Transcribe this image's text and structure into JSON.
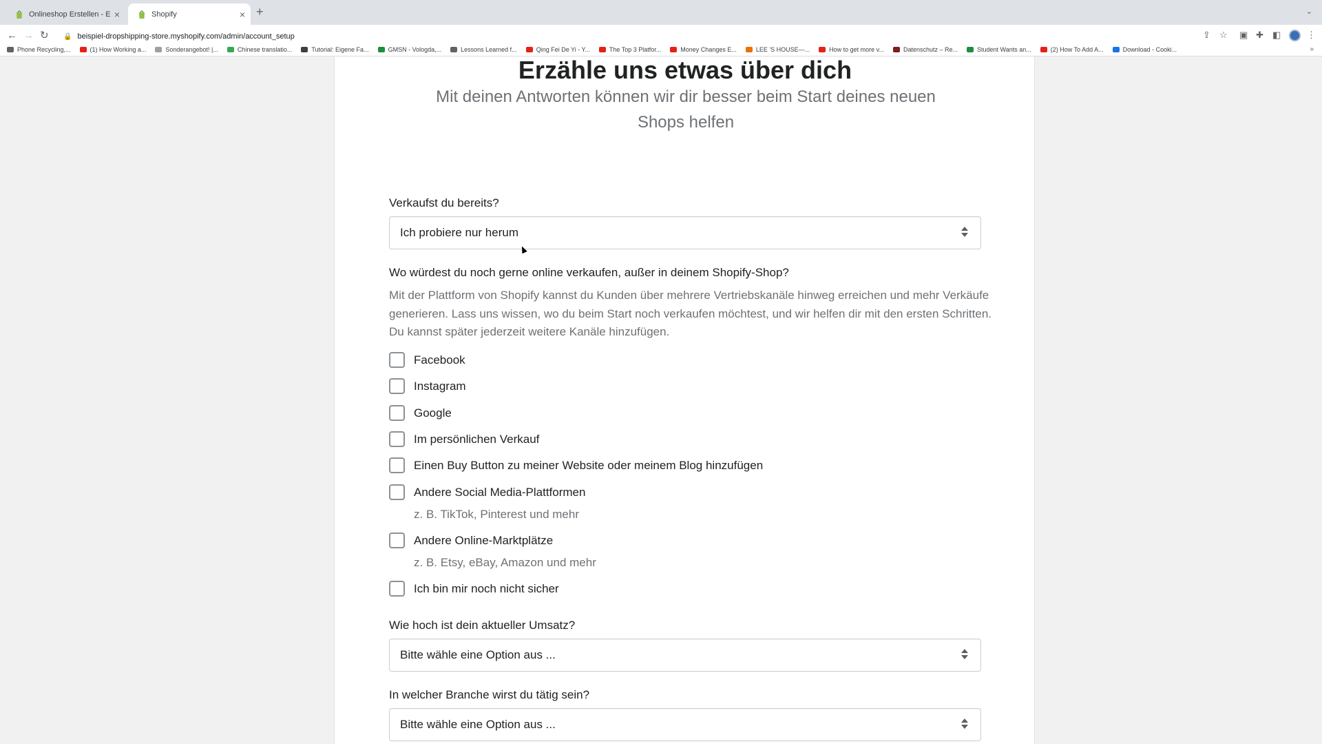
{
  "browser": {
    "tabs": [
      {
        "title": "Onlineshop Erstellen - Einfach",
        "active": false
      },
      {
        "title": "Shopify",
        "active": true
      }
    ],
    "url": "beispiel-dropshipping-store.myshopify.com/admin/account_setup",
    "bookmarks": [
      {
        "label": "Phone Recycling,...",
        "color": "#5f6368"
      },
      {
        "label": "(1) How Working a...",
        "color": "#e62117"
      },
      {
        "label": "Sonderangebot! |...",
        "color": "#9aa0a6"
      },
      {
        "label": "Chinese translatio...",
        "color": "#34a853"
      },
      {
        "label": "Tutorial: Eigene Fa...",
        "color": "#3c4043"
      },
      {
        "label": "GMSN - Vologda,...",
        "color": "#1e8e3e"
      },
      {
        "label": "Lessons Learned f...",
        "color": "#5f6368"
      },
      {
        "label": "Qing Fei De Yi - Y...",
        "color": "#e62117"
      },
      {
        "label": "The Top 3 Platfor...",
        "color": "#e62117"
      },
      {
        "label": "Money Changes E...",
        "color": "#e62117"
      },
      {
        "label": "LEE 'S HOUSE—...",
        "color": "#e8710a"
      },
      {
        "label": "How to get more v...",
        "color": "#e62117"
      },
      {
        "label": "Datenschutz – Re...",
        "color": "#7b1f1f"
      },
      {
        "label": "Student Wants an...",
        "color": "#1e8e3e"
      },
      {
        "label": "(2) How To Add A...",
        "color": "#e62117"
      },
      {
        "label": "Download - Cooki...",
        "color": "#1a73e8"
      }
    ]
  },
  "page": {
    "title": "Erzähle uns etwas über dich",
    "subtitle": "Mit deinen Antworten können wir dir besser beim Start deines neuen Shops helfen"
  },
  "form": {
    "q1": {
      "label": "Verkaufst du bereits?",
      "value": "Ich probiere nur herum"
    },
    "q2": {
      "label": "Wo würdest du noch gerne online verkaufen, außer in deinem Shopify-Shop?",
      "description": "Mit der Plattform von Shopify kannst du Kunden über mehrere Vertriebskanäle hinweg erreichen und mehr Verkäufe generieren. Lass uns wissen, wo du beim Start noch verkaufen möchtest, und wir helfen dir mit den ersten Schritten. Du kannst später jederzeit weitere Kanäle hinzufügen.",
      "options": [
        {
          "label": "Facebook",
          "checked": false
        },
        {
          "label": "Instagram",
          "checked": false
        },
        {
          "label": "Google",
          "checked": false
        },
        {
          "label": "Im persönlichen Verkauf",
          "checked": false
        },
        {
          "label": "Einen Buy Button zu meiner Website oder meinem Blog hinzufügen",
          "checked": false
        },
        {
          "label": "Andere Social Media-Plattformen",
          "hint": "z. B. TikTok, Pinterest und mehr",
          "checked": false
        },
        {
          "label": "Andere Online-Marktplätze",
          "hint": "z. B. Etsy, eBay, Amazon und mehr",
          "checked": false
        },
        {
          "label": "Ich bin mir noch nicht sicher",
          "checked": false
        }
      ]
    },
    "q3": {
      "label": "Wie hoch ist dein aktueller Umsatz?",
      "value": "Bitte wähle eine Option aus ..."
    },
    "q4": {
      "label": "In welcher Branche wirst du tätig sein?",
      "value": "Bitte wähle eine Option aus ..."
    }
  },
  "colors": {
    "background": "#f1f1f1",
    "card": "#ffffff",
    "text": "#202223",
    "subdued": "#6d7175"
  }
}
